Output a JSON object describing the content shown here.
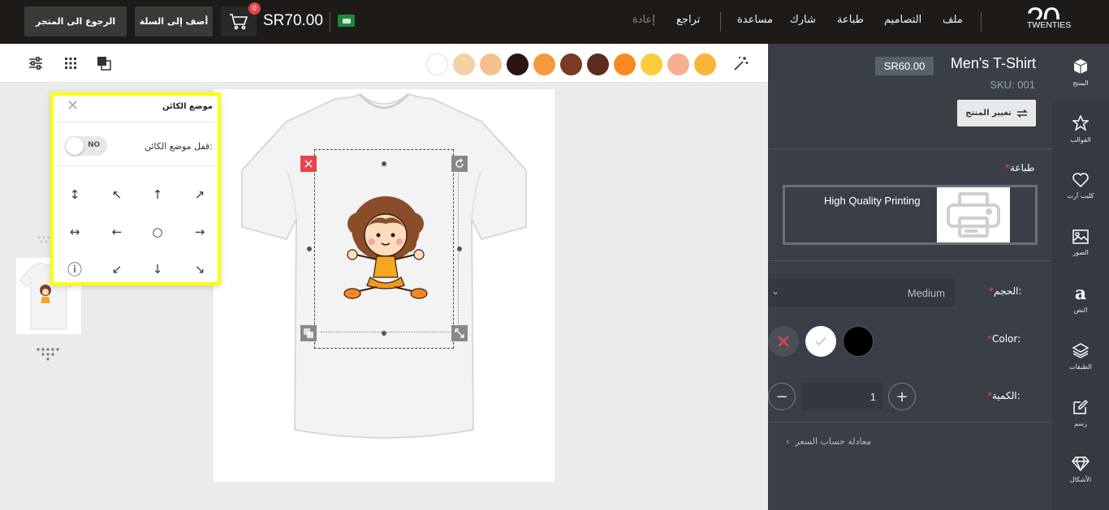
{
  "topbar": {
    "back_label": "الرجوع الى المتجر",
    "add_label": "أضف إلى السلة",
    "cart_count": "0",
    "total": "SR70.00",
    "menu": [
      "ملف",
      "التصاميم",
      "طباعة",
      "شارك",
      "مساعدة",
      "تراجع",
      "إعادة"
    ],
    "logo_number": "20",
    "logo_word": "TWENTIES"
  },
  "toolbar": {
    "icons": [
      "adjust-icon",
      "grid-icon",
      "layers-front-icon",
      "magic-wand-icon"
    ],
    "swatches": [
      "#ffffff",
      "#f4d0a6",
      "#f5c08e",
      "#2a1512",
      "#f39a3c",
      "#7a3a24",
      "#5b2c1c",
      "#f58a1f",
      "#fccc3c",
      "#f5b090",
      "#f9b43a"
    ]
  },
  "popup": {
    "title": "موضع الكائن",
    "lock_label": "قفل موضع الكائن:",
    "toggle_text": "NO",
    "arrows": [
      "↗",
      "↑",
      "↖",
      "↕",
      "→",
      "○",
      "←",
      "↔",
      "↘",
      "↓",
      "↙",
      "ⓘ"
    ]
  },
  "panel": {
    "price": "SR60.00",
    "title": "Men's T-Shirt",
    "sku": "SKU: 001",
    "change_label": "تغيير المنتج",
    "print_label": "طباعة",
    "print_option": "High Quality Printing",
    "size_label": "الحجم:",
    "size_value": "Medium",
    "color_label": "Color:",
    "colors": [
      "#ffffff",
      "#000000"
    ],
    "qty_label": "الكمية:",
    "qty_value": "1",
    "formula_label": "معادلة حساب السعر"
  },
  "sidebar": {
    "items": [
      "المنتج",
      "القوالب",
      "كليب آرت",
      "الصور",
      "النص",
      "الطبقات",
      "رسم",
      "الأشكال"
    ]
  }
}
